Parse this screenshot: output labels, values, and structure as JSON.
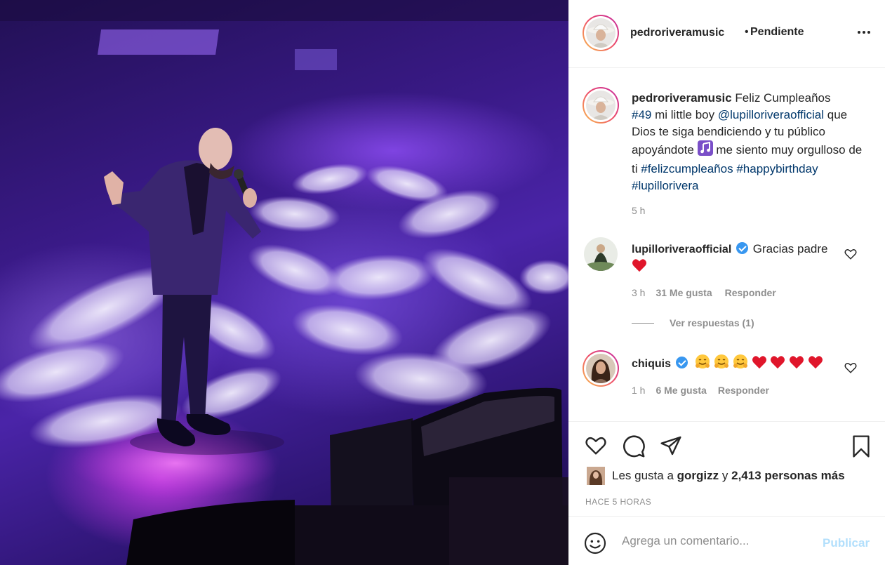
{
  "post": {
    "image_alt": ""
  },
  "header": {
    "username": "pedroriveramusic",
    "separator": "•",
    "follow_status": "Pendiente",
    "more_icon": "more-horizontal-icon"
  },
  "caption": {
    "username": "pedroriveramusic",
    "text_1": "Feliz Cumpleaños",
    "hashtag_1": "#49",
    "text_2": "mi little boy",
    "mention": "@lupilloriveraofficial",
    "text_3": "que Dios te siga bendiciendo y tu público apoyándote",
    "text_4": "me siento muy orgulloso de ti",
    "hashtag_2": "#felizcumpleaños",
    "hashtag_3": "#happybirthday",
    "hashtag_4": "#lupillorivera",
    "time": "5 h"
  },
  "comments": [
    {
      "username": "lupilloriveraofficial",
      "text": "Gracias padre",
      "time": "3 h",
      "likes": "31 Me gusta",
      "reply": "Responder"
    },
    {
      "username": "chiquis",
      "time": "1 h",
      "likes": "6 Me gusta",
      "reply": "Responder"
    }
  ],
  "view_replies": "Ver respuestas (1)",
  "actions": {
    "liked_by_prefix": "Les gusta a",
    "liked_by_user": "gorgizz",
    "liked_by_conj": "y",
    "liked_by_count": "2,413 personas más",
    "posted": "HACE 5 HORAS"
  },
  "add_comment": {
    "placeholder": "Agrega un comentario...",
    "publish": "Publicar"
  },
  "colors": {
    "link": "#00376b",
    "muted": "#8e8e8e",
    "verified": "#3897f0",
    "publish_disabled": "#b2dffc"
  }
}
